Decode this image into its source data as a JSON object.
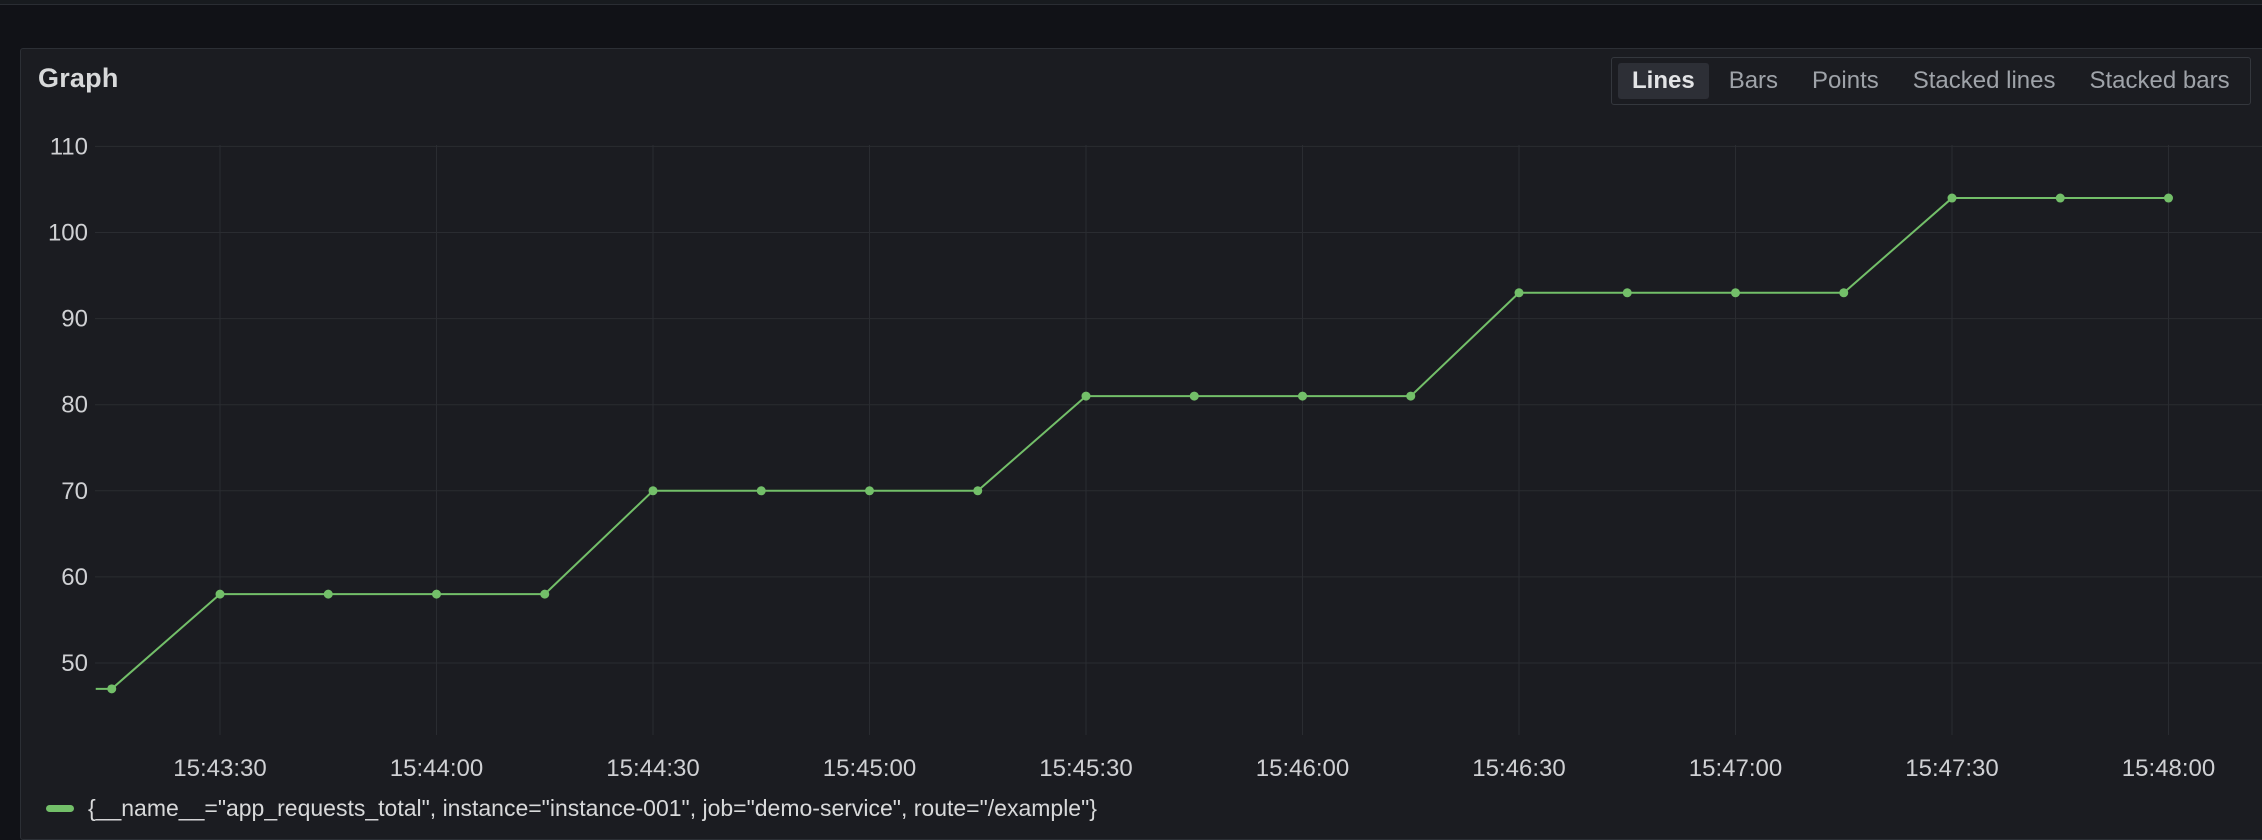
{
  "panel": {
    "title": "Graph",
    "modes": [
      "Lines",
      "Bars",
      "Points",
      "Stacked lines",
      "Stacked bars"
    ],
    "active_mode": "Lines"
  },
  "legend": {
    "label": "{__name__=\"app_requests_total\", instance=\"instance-001\", job=\"demo-service\", route=\"/example\"}",
    "color": "#73bf69"
  },
  "chart_data": {
    "type": "line",
    "title": "",
    "xlabel": "",
    "ylabel": "",
    "x_ticks": [
      "15:43:30",
      "15:44:00",
      "15:44:30",
      "15:45:00",
      "15:45:30",
      "15:46:00",
      "15:46:30",
      "15:47:00",
      "15:47:30",
      "15:48:00"
    ],
    "y_ticks": [
      50,
      60,
      70,
      80,
      90,
      100,
      110
    ],
    "ylim": [
      44,
      110
    ],
    "xlim": [
      "15:43:15",
      "15:48:13"
    ],
    "grid": true,
    "series": [
      {
        "name": "{__name__=\"app_requests_total\", instance=\"instance-001\", job=\"demo-service\", route=\"/example\"}",
        "color": "#73bf69",
        "x": [
          "15:43:15",
          "15:43:30",
          "15:43:45",
          "15:44:00",
          "15:44:15",
          "15:44:30",
          "15:44:45",
          "15:45:00",
          "15:45:15",
          "15:45:30",
          "15:45:45",
          "15:46:00",
          "15:46:15",
          "15:46:30",
          "15:46:45",
          "15:47:00",
          "15:47:15",
          "15:47:30",
          "15:47:45",
          "15:48:00"
        ],
        "values": [
          47,
          58,
          58,
          58,
          58,
          70,
          70,
          70,
          70,
          81,
          81,
          81,
          81,
          93,
          93,
          93,
          93,
          104,
          104,
          104
        ]
      }
    ]
  }
}
